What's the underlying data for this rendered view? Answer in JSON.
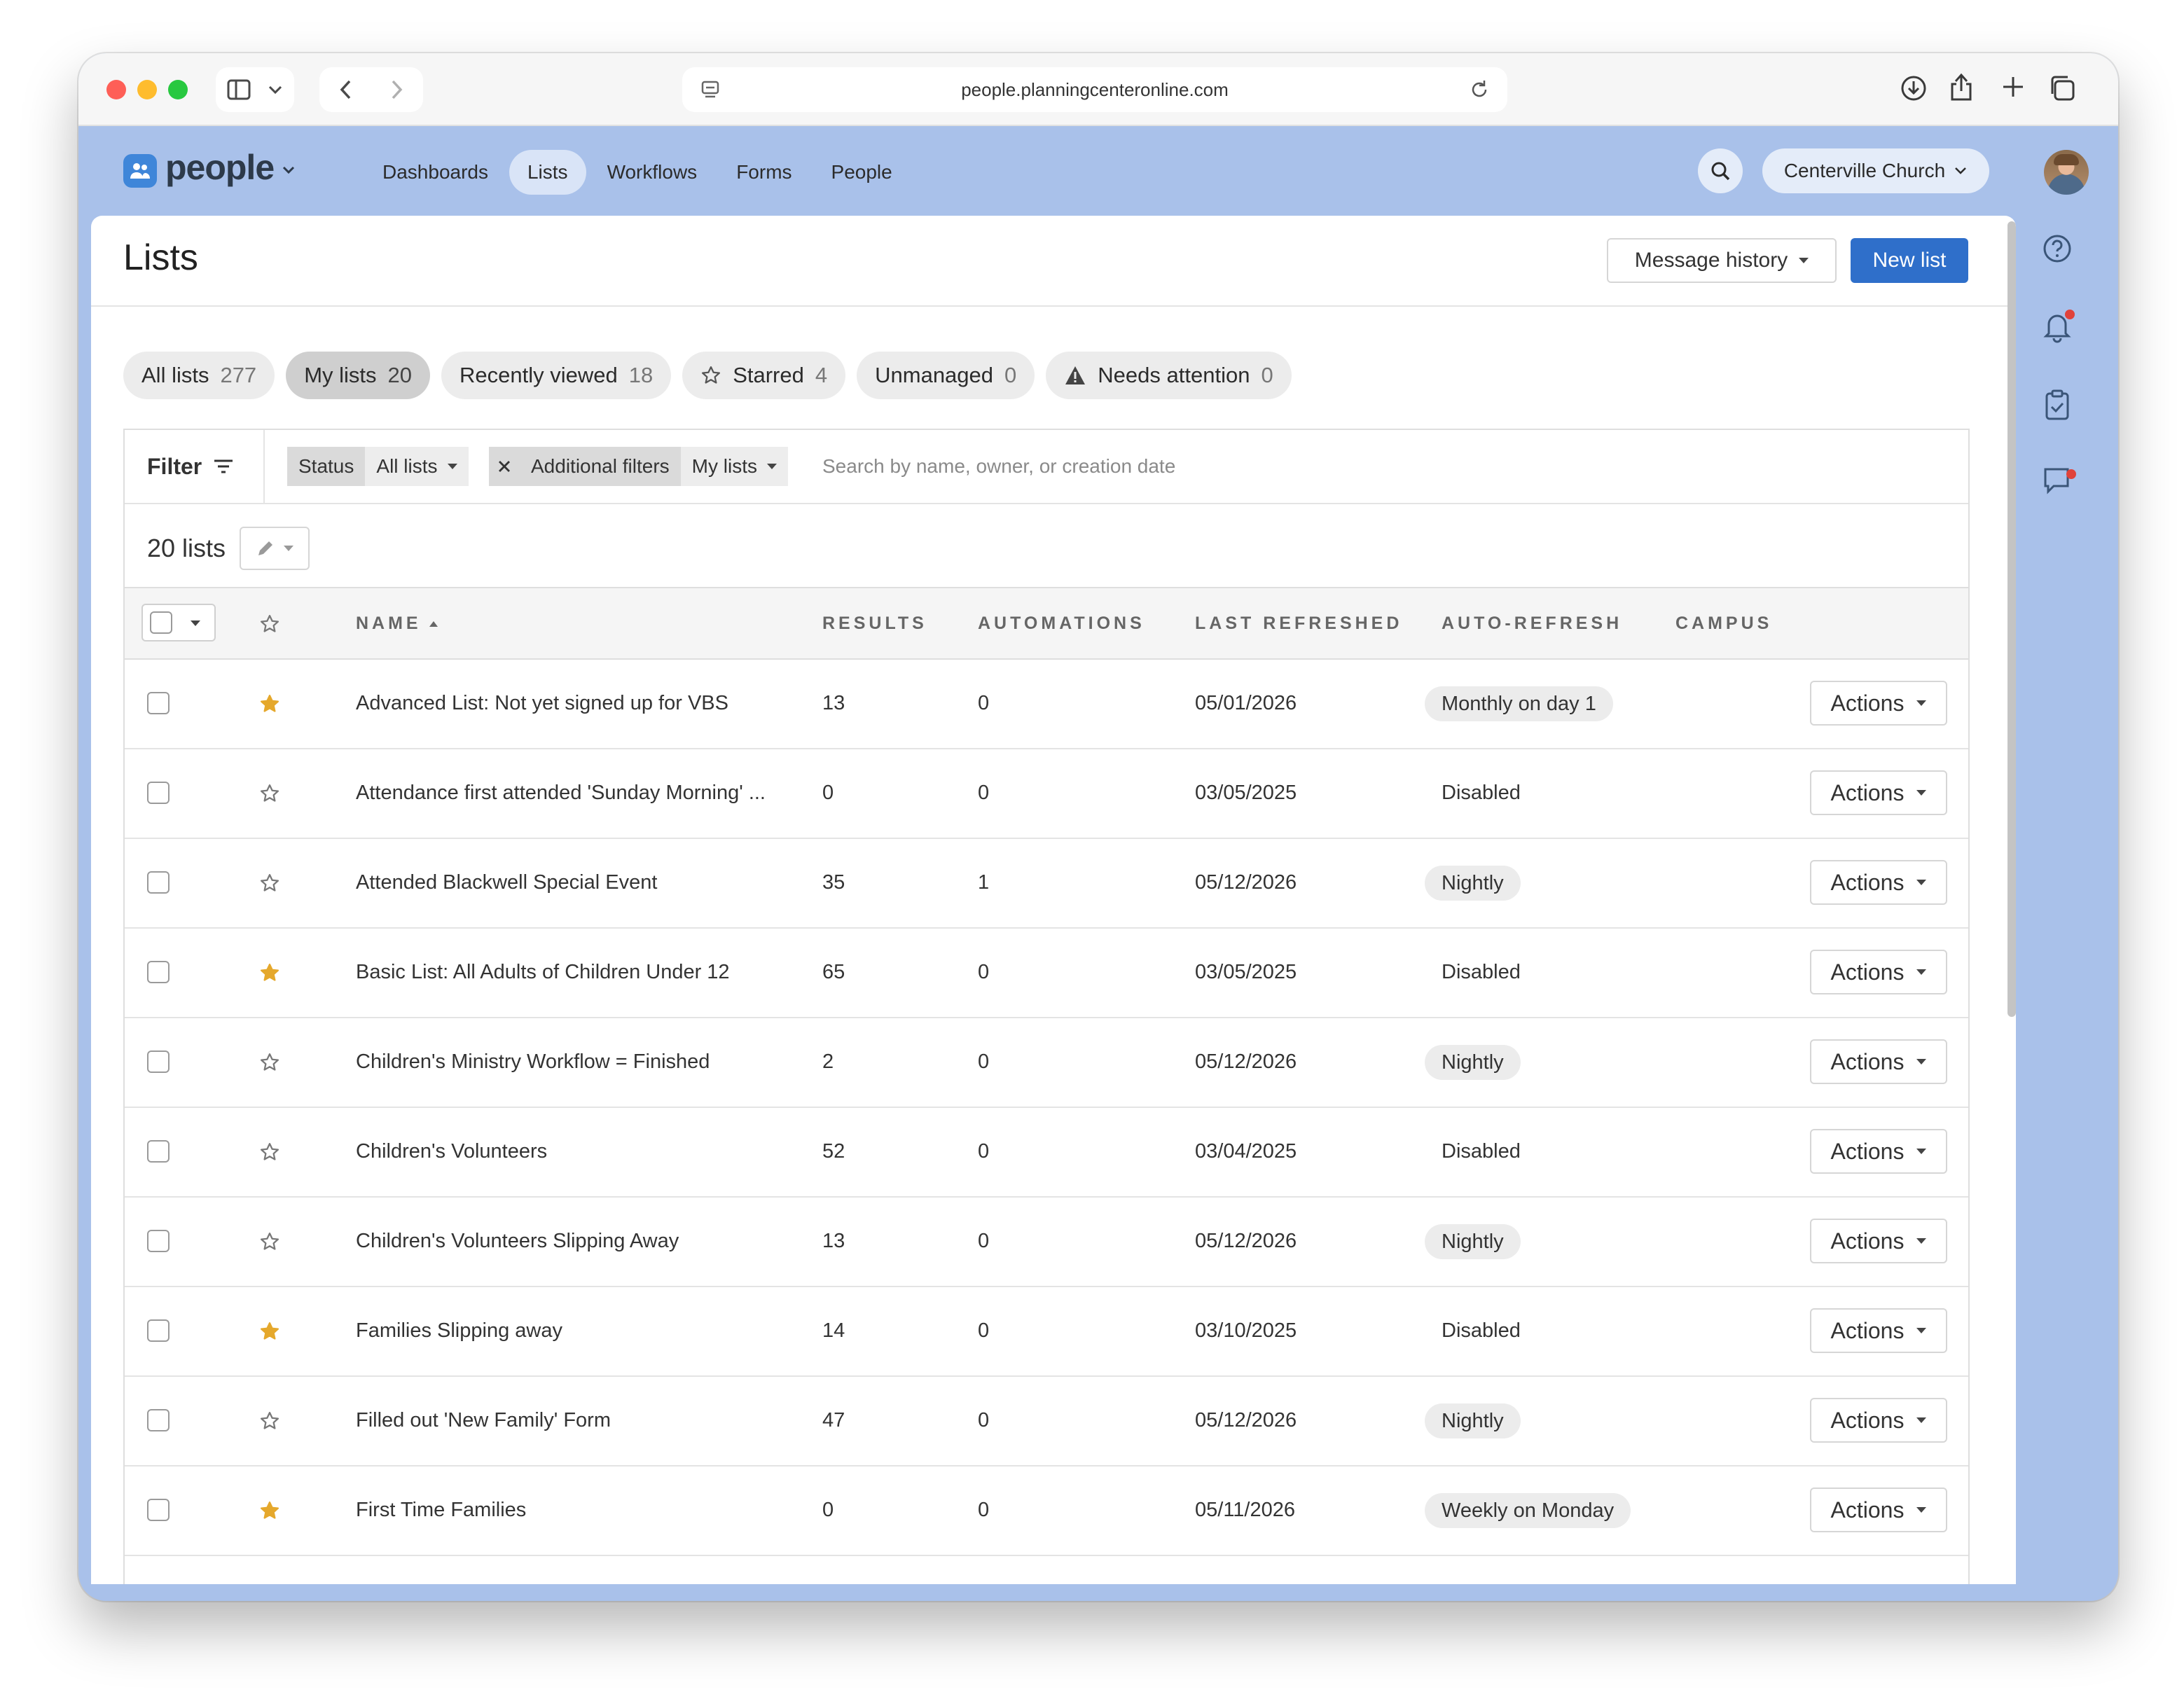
{
  "browser": {
    "url": "people.planningcenteronline.com"
  },
  "app": {
    "logo_text": "people",
    "nav": [
      {
        "label": "Dashboards",
        "active": false
      },
      {
        "label": "Lists",
        "active": true
      },
      {
        "label": "Workflows",
        "active": false
      },
      {
        "label": "Forms",
        "active": false
      },
      {
        "label": "People",
        "active": false
      }
    ],
    "org_name": "Centerville Church"
  },
  "page": {
    "title": "Lists",
    "message_history_label": "Message history",
    "new_list_label": "New list"
  },
  "tabs": [
    {
      "label": "All lists",
      "count": "277",
      "active": false,
      "icon": ""
    },
    {
      "label": "My lists",
      "count": "20",
      "active": true,
      "icon": ""
    },
    {
      "label": "Recently viewed",
      "count": "18",
      "active": false,
      "icon": ""
    },
    {
      "label": "Starred",
      "count": "4",
      "active": false,
      "icon": "star-outline-icon"
    },
    {
      "label": "Unmanaged",
      "count": "0",
      "active": false,
      "icon": ""
    },
    {
      "label": "Needs attention",
      "count": "0",
      "active": false,
      "icon": "warning-icon"
    }
  ],
  "filters": {
    "label": "Filter",
    "status_label": "Status",
    "status_value": "All lists",
    "additional_label": "Additional filters",
    "additional_value": "My lists",
    "search_placeholder": "Search by name, owner, or creation date"
  },
  "table": {
    "count_label": "20 lists",
    "columns": {
      "name": "NAME",
      "results": "RESULTS",
      "automations": "AUTOMATIONS",
      "last_refreshed": "LAST REFRESHED",
      "auto_refresh": "AUTO-REFRESH",
      "campus": "CAMPUS"
    },
    "action_label": "Actions",
    "rows": [
      {
        "starred": true,
        "name": "Advanced List: Not yet signed up for VBS",
        "results": "13",
        "automations": "0",
        "last_refreshed": "05/01/2026",
        "auto_refresh": "Monthly on day 1",
        "pill": true
      },
      {
        "starred": false,
        "name": "Attendance first attended 'Sunday Morning' ...",
        "results": "0",
        "automations": "0",
        "last_refreshed": "03/05/2025",
        "auto_refresh": "Disabled",
        "pill": false
      },
      {
        "starred": false,
        "name": "Attended Blackwell Special Event",
        "results": "35",
        "automations": "1",
        "last_refreshed": "05/12/2026",
        "auto_refresh": "Nightly",
        "pill": true
      },
      {
        "starred": true,
        "name": "Basic List: All Adults of Children Under 12",
        "results": "65",
        "automations": "0",
        "last_refreshed": "03/05/2025",
        "auto_refresh": "Disabled",
        "pill": false
      },
      {
        "starred": false,
        "name": "Children's Ministry Workflow = Finished",
        "results": "2",
        "automations": "0",
        "last_refreshed": "05/12/2026",
        "auto_refresh": "Nightly",
        "pill": true
      },
      {
        "starred": false,
        "name": "Children's Volunteers",
        "results": "52",
        "automations": "0",
        "last_refreshed": "03/04/2025",
        "auto_refresh": "Disabled",
        "pill": false
      },
      {
        "starred": false,
        "name": "Children's Volunteers Slipping Away",
        "results": "13",
        "automations": "0",
        "last_refreshed": "05/12/2026",
        "auto_refresh": "Nightly",
        "pill": true
      },
      {
        "starred": true,
        "name": "Families Slipping away",
        "results": "14",
        "automations": "0",
        "last_refreshed": "03/10/2025",
        "auto_refresh": "Disabled",
        "pill": false
      },
      {
        "starred": false,
        "name": "Filled out 'New Family' Form",
        "results": "47",
        "automations": "0",
        "last_refreshed": "05/12/2026",
        "auto_refresh": "Nightly",
        "pill": true
      },
      {
        "starred": true,
        "name": "First Time Families",
        "results": "0",
        "automations": "0",
        "last_refreshed": "05/11/2026",
        "auto_refresh": "Weekly on Monday",
        "pill": true
      }
    ]
  },
  "colors": {
    "primary": "#2f6fca",
    "star_filled": "#e5a82c",
    "header_bg": "#a9c1ea",
    "notification_dot": "#e0423a"
  }
}
